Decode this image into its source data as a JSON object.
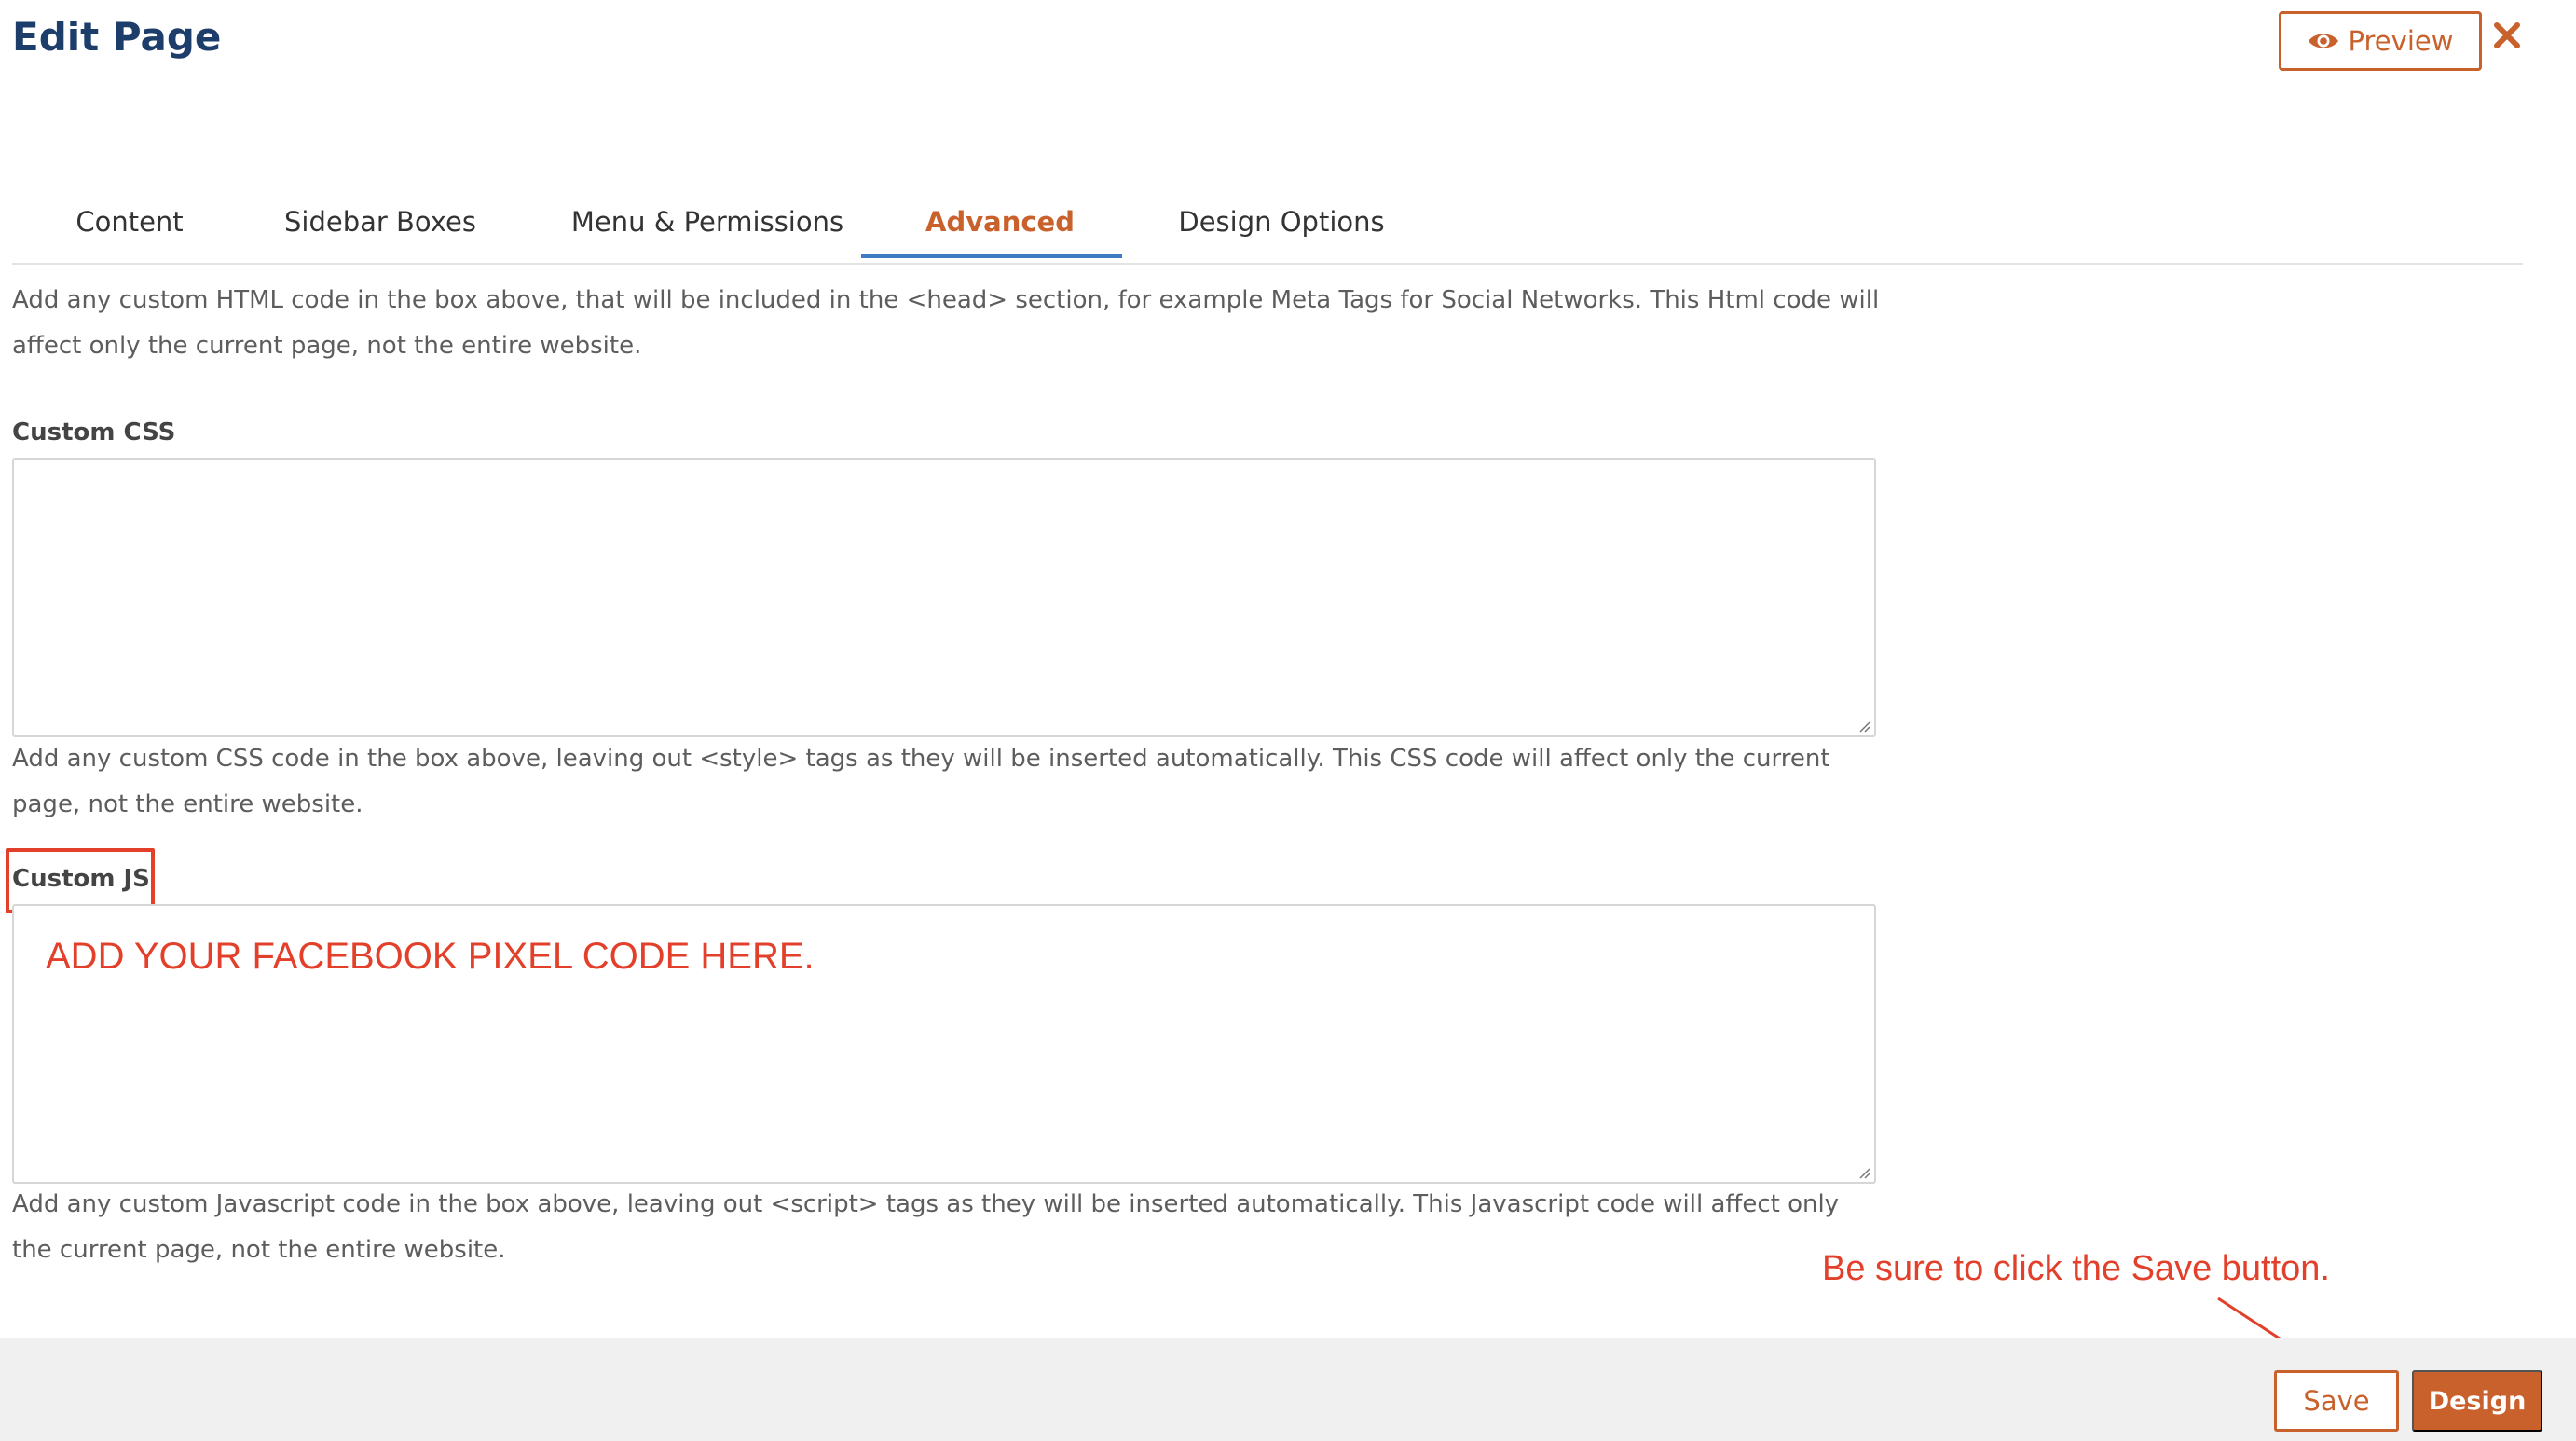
{
  "header": {
    "title": "Edit Page",
    "preview_label": "Preview",
    "preview_icon": "eye-icon",
    "close_icon": "close-icon"
  },
  "tabs": [
    {
      "label": "Content",
      "active": false
    },
    {
      "label": "Sidebar Boxes",
      "active": false
    },
    {
      "label": "Menu & Permissions",
      "active": false
    },
    {
      "label": "Advanced",
      "active": true
    },
    {
      "label": "Design Options",
      "active": false
    }
  ],
  "sections": {
    "head_help": "Add any custom HTML code in the box above, that will be included in the <head> section, for example Meta Tags for Social Networks. This Html code will affect only the current page, not the entire website.",
    "custom_css": {
      "label": "Custom CSS",
      "value": "",
      "help": "Add any custom CSS code in the box above, leaving out <style> tags as they will be inserted automatically. This CSS code will affect only the current page, not the entire website."
    },
    "custom_js": {
      "label": "Custom JS",
      "value": "",
      "help": "Add any custom Javascript code in the box above, leaving out <script> tags as they will be inserted automatically. This Javascript code will affect only the current page, not the entire website."
    }
  },
  "annotations": {
    "js_placeholder": "ADD YOUR FACEBOOK PIXEL CODE HERE.",
    "save_hint": "Be sure to click the Save button."
  },
  "footer": {
    "save_label": "Save",
    "design_label": "Design"
  },
  "colors": {
    "title": "#1d3d6a",
    "accent": "#c9612c",
    "tab_underline": "#3d7cc0",
    "annotation": "#e2402a",
    "footer_bg": "#f0f0f0"
  }
}
